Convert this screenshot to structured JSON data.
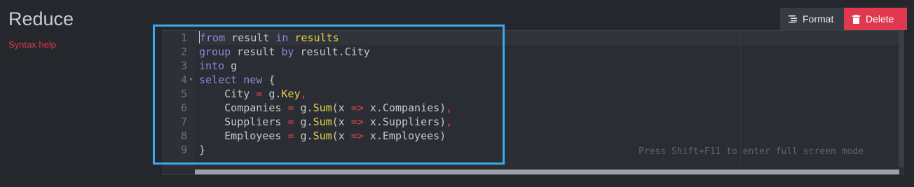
{
  "header": {
    "title": "Reduce",
    "syntax_help": "Syntax help"
  },
  "toolbar": {
    "format_label": "Format",
    "delete_label": "Delete"
  },
  "editor": {
    "line_numbers": [
      "1",
      "2",
      "3",
      "4",
      "5",
      "6",
      "7",
      "8",
      "9"
    ],
    "lines": [
      "from result in results",
      "group result by result.City",
      "into g",
      "select new {",
      "    City = g.Key,",
      "    Companies = g.Sum(x => x.Companies),",
      "    Suppliers = g.Sum(x => x.Suppliers),",
      "    Employees = g.Sum(x => x.Employees)",
      "}"
    ],
    "hint": "Press Shift+F11 to enter full screen mode"
  },
  "colors": {
    "accent_red": "#e0384f",
    "highlight_blue": "#3ba9ef",
    "keyword": "#8f86d9",
    "function": "#e3d343",
    "operator": "#e0474c"
  }
}
